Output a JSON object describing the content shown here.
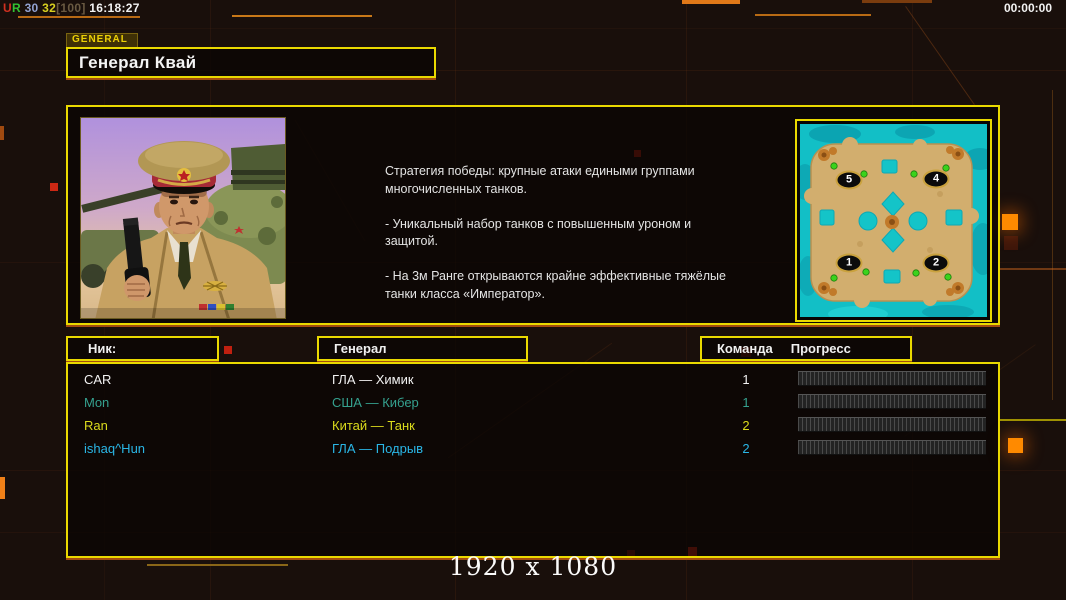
{
  "topbar": {
    "net_u": "U",
    "net_r": "R",
    "stat1": "30",
    "stat2": "32",
    "stat3": "[100]",
    "clock": "16:18:27",
    "timer": "00:00:00"
  },
  "general_tab": {
    "label": "GENERAL"
  },
  "title": {
    "text": "Генерал Квай"
  },
  "description": {
    "paragraphs": [
      "Стратегия победы: крупные атаки едиными группами многочисленных танков.",
      "- Уникальный набор танков с повышенным уроном и защитой.",
      "- На 3м Ранге открываются крайне эффективные тяжёлые танки класса «Император»."
    ]
  },
  "map": {
    "spawn_points": [
      "5",
      "4",
      "1",
      "2"
    ]
  },
  "table": {
    "headers": {
      "nick": "Ник:",
      "general": "Генерал",
      "team": "Команда",
      "progress": "Прогресс"
    },
    "rows": [
      {
        "nick": "CAR",
        "general": "ГЛА — Химик",
        "team": "1",
        "color": "#f2f2f2"
      },
      {
        "nick": "Mon",
        "general": "США — Кибер",
        "team": "1",
        "color": "#35a18f"
      },
      {
        "nick": "Ran",
        "general": "Китай — Танк",
        "team": "2",
        "color": "#dada1c"
      },
      {
        "nick": "ishaq^Hun",
        "general": "ГЛА — Подрыв",
        "team": "2",
        "color": "#2ab6e6"
      }
    ]
  },
  "footer": {
    "resolution": "1920 x 1080"
  },
  "colors": {
    "border-yellow": "#ead900",
    "border-orange": "#a24c10"
  }
}
